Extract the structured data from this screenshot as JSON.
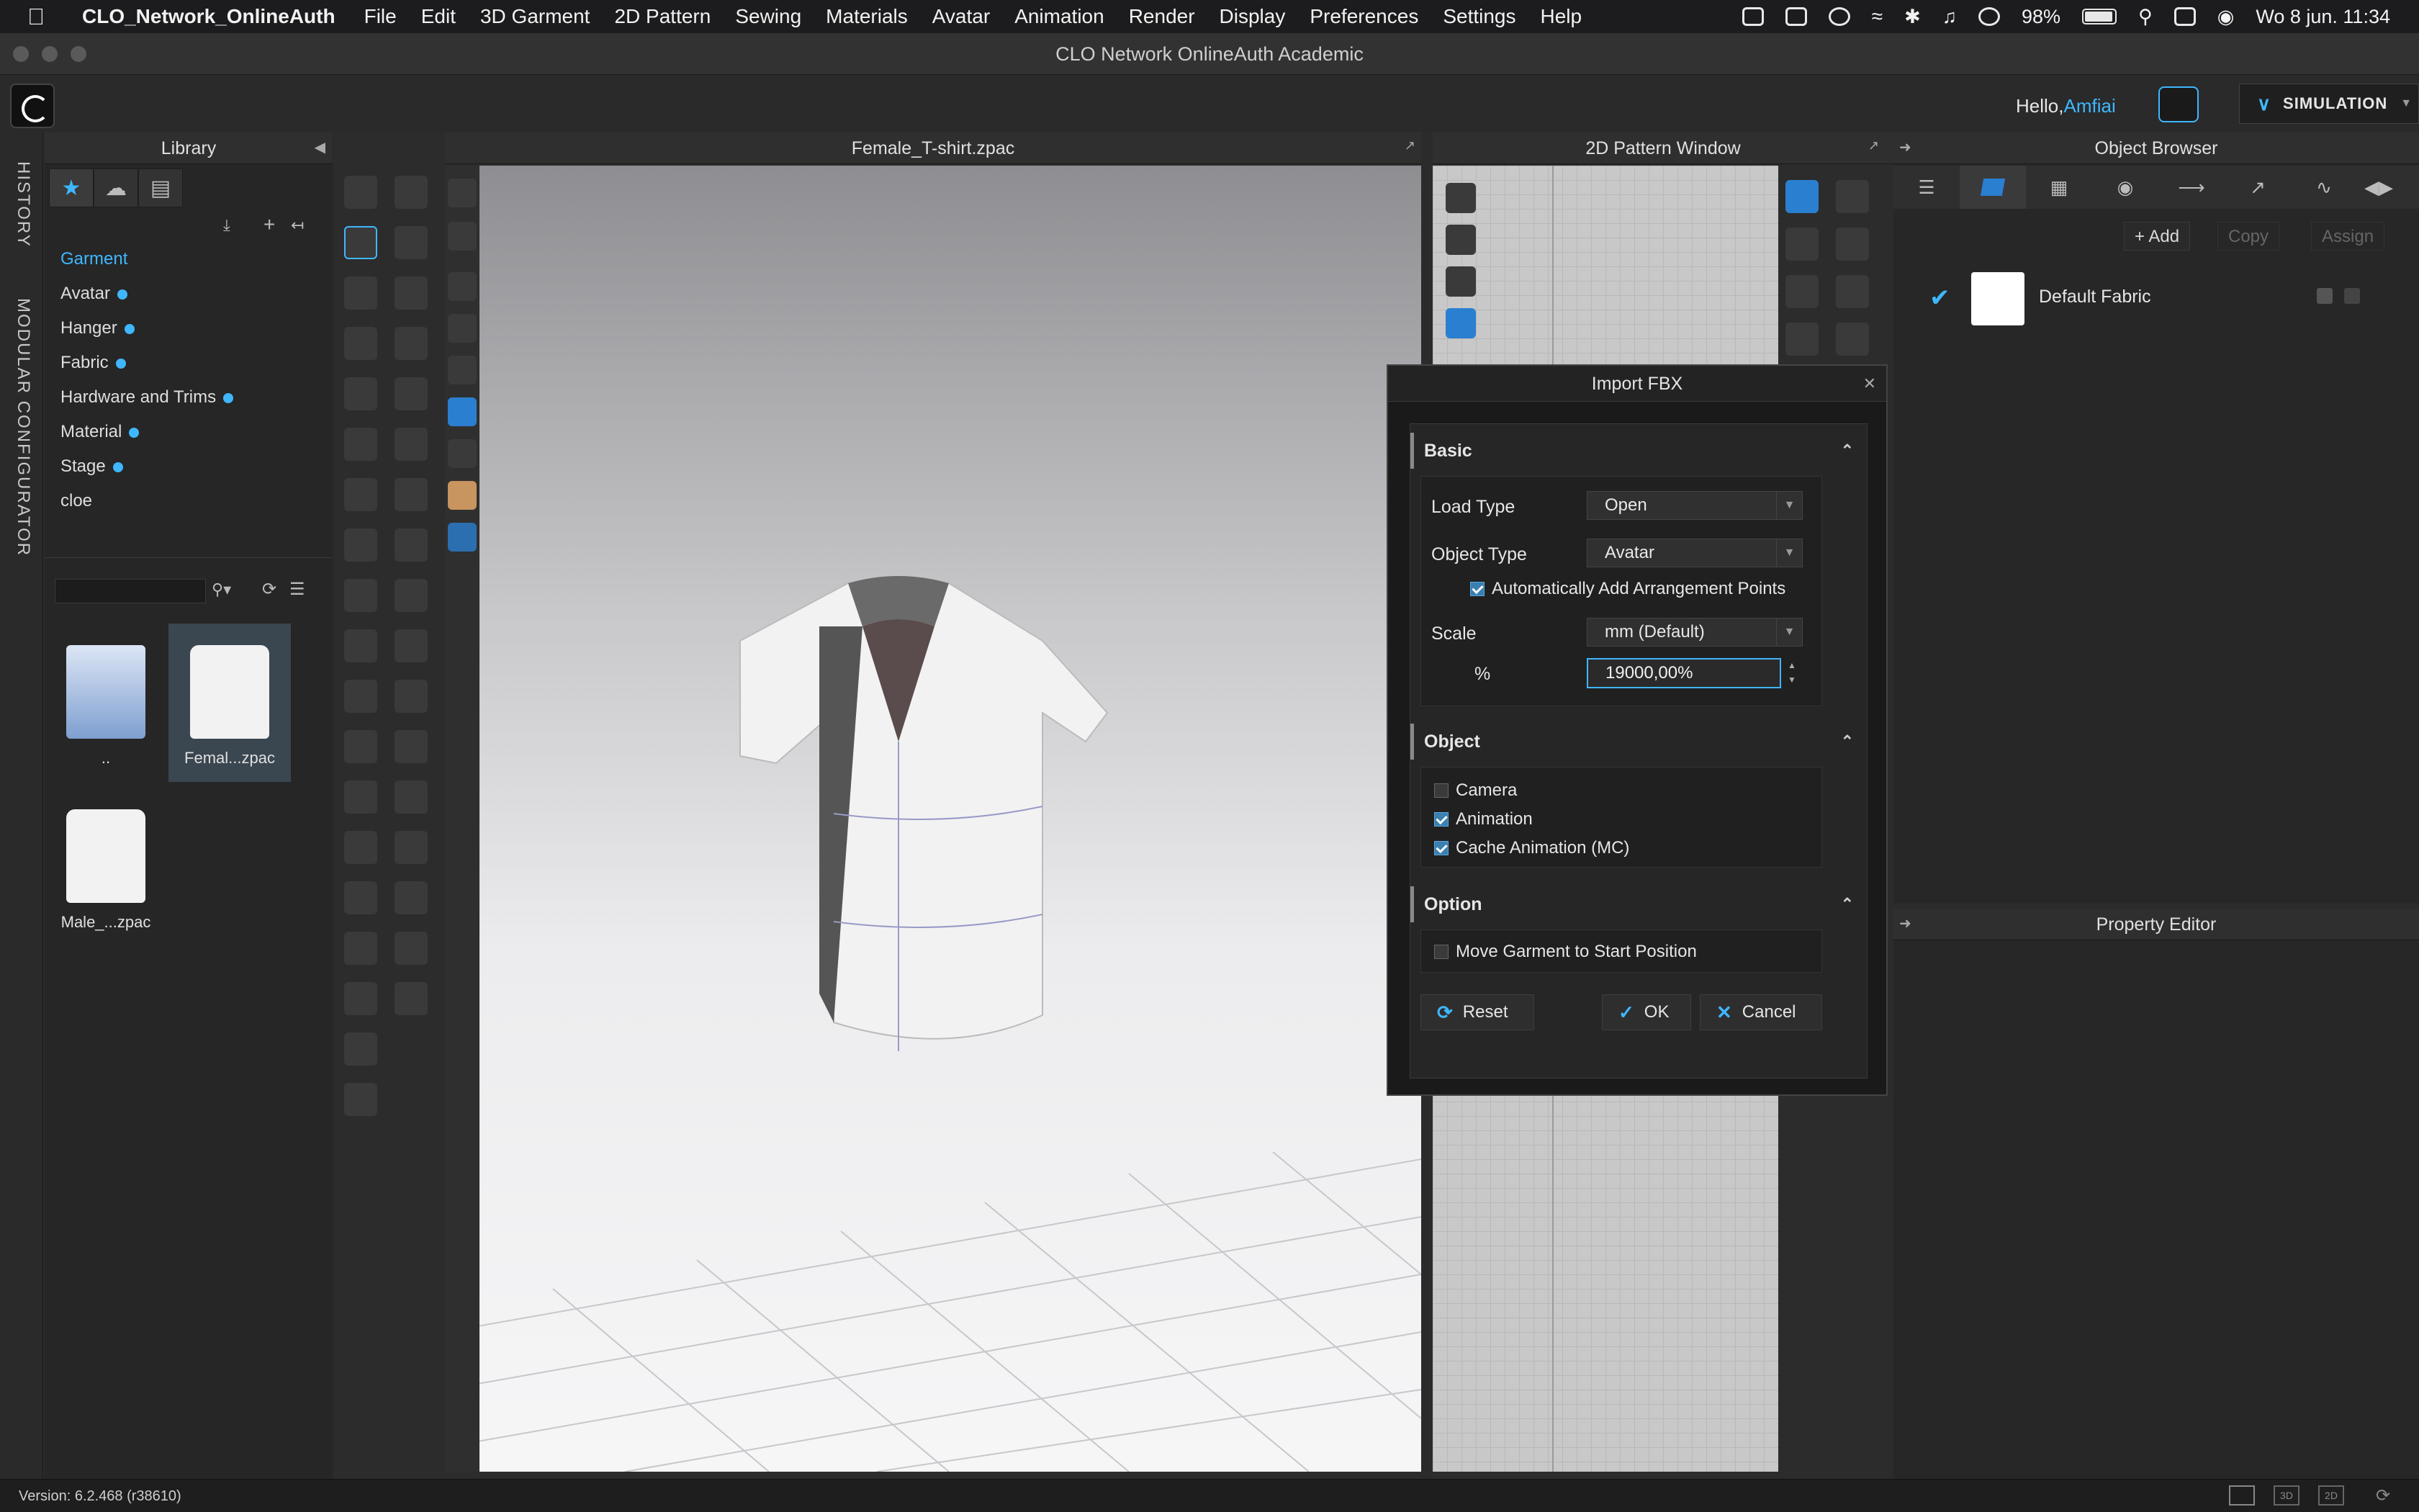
{
  "menubar": {
    "app_name": "CLO_Network_OnlineAuth",
    "menus": [
      "File",
      "Edit",
      "3D Garment",
      "2D Pattern",
      "Sewing",
      "Materials",
      "Avatar",
      "Animation",
      "Render",
      "Display",
      "Preferences",
      "Settings",
      "Help"
    ],
    "battery": "98%",
    "datetime": "Wo 8 jun.  11:34"
  },
  "window": {
    "title": "CLO Network OnlineAuth Academic"
  },
  "header": {
    "greeting": "Hello,",
    "username": "Amfiai",
    "mode_label": "SIMULATION"
  },
  "side_tabs": [
    "HISTORY",
    "MODULAR CONFIGURATOR"
  ],
  "library": {
    "title": "Library",
    "items": [
      {
        "label": "Garment",
        "selected": true,
        "new": false
      },
      {
        "label": "Avatar",
        "selected": false,
        "new": true
      },
      {
        "label": "Hanger",
        "selected": false,
        "new": true
      },
      {
        "label": "Fabric",
        "selected": false,
        "new": true
      },
      {
        "label": "Hardware and Trims",
        "selected": false,
        "new": true
      },
      {
        "label": "Material",
        "selected": false,
        "new": true
      },
      {
        "label": "Stage",
        "selected": false,
        "new": true
      },
      {
        "label": "cloe",
        "selected": false,
        "new": false
      }
    ],
    "files": [
      {
        "label": "..",
        "kind": "folder"
      },
      {
        "label": "Femal...zpac",
        "kind": "garment",
        "selected": true
      },
      {
        "label": "Male_...zpac",
        "kind": "garment"
      }
    ]
  },
  "viewport3d": {
    "title": "Female_T-shirt.zpac"
  },
  "pattern2d": {
    "title": "2D Pattern Window"
  },
  "object_browser": {
    "title": "Object Browser",
    "add_label": "Add",
    "copy_label": "Copy",
    "assign_label": "Assign",
    "fabric_name": "Default Fabric"
  },
  "property_editor": {
    "title": "Property Editor"
  },
  "dialog": {
    "title": "Import FBX",
    "basic_section": "Basic",
    "load_type_label": "Load Type",
    "load_type_value": "Open",
    "object_type_label": "Object Type",
    "object_type_value": "Avatar",
    "auto_arrange_label": "Automatically Add Arrangement Points",
    "auto_arrange_checked": true,
    "scale_label": "Scale",
    "scale_value": "mm (Default)",
    "percent_label": "%",
    "percent_value": "19000,00%",
    "object_section": "Object",
    "camera_label": "Camera",
    "camera_checked": false,
    "animation_label": "Animation",
    "animation_checked": true,
    "cache_label": "Cache Animation (MC)",
    "cache_checked": true,
    "option_section": "Option",
    "move_garment_label": "Move Garment to Start Position",
    "move_garment_checked": false,
    "reset_label": "Reset",
    "ok_label": "OK",
    "cancel_label": "Cancel"
  },
  "status": {
    "version": "Version: 6.2.468 (r38610)"
  },
  "colors": {
    "accent": "#3fb7ff",
    "background": "#2b2b2b"
  }
}
